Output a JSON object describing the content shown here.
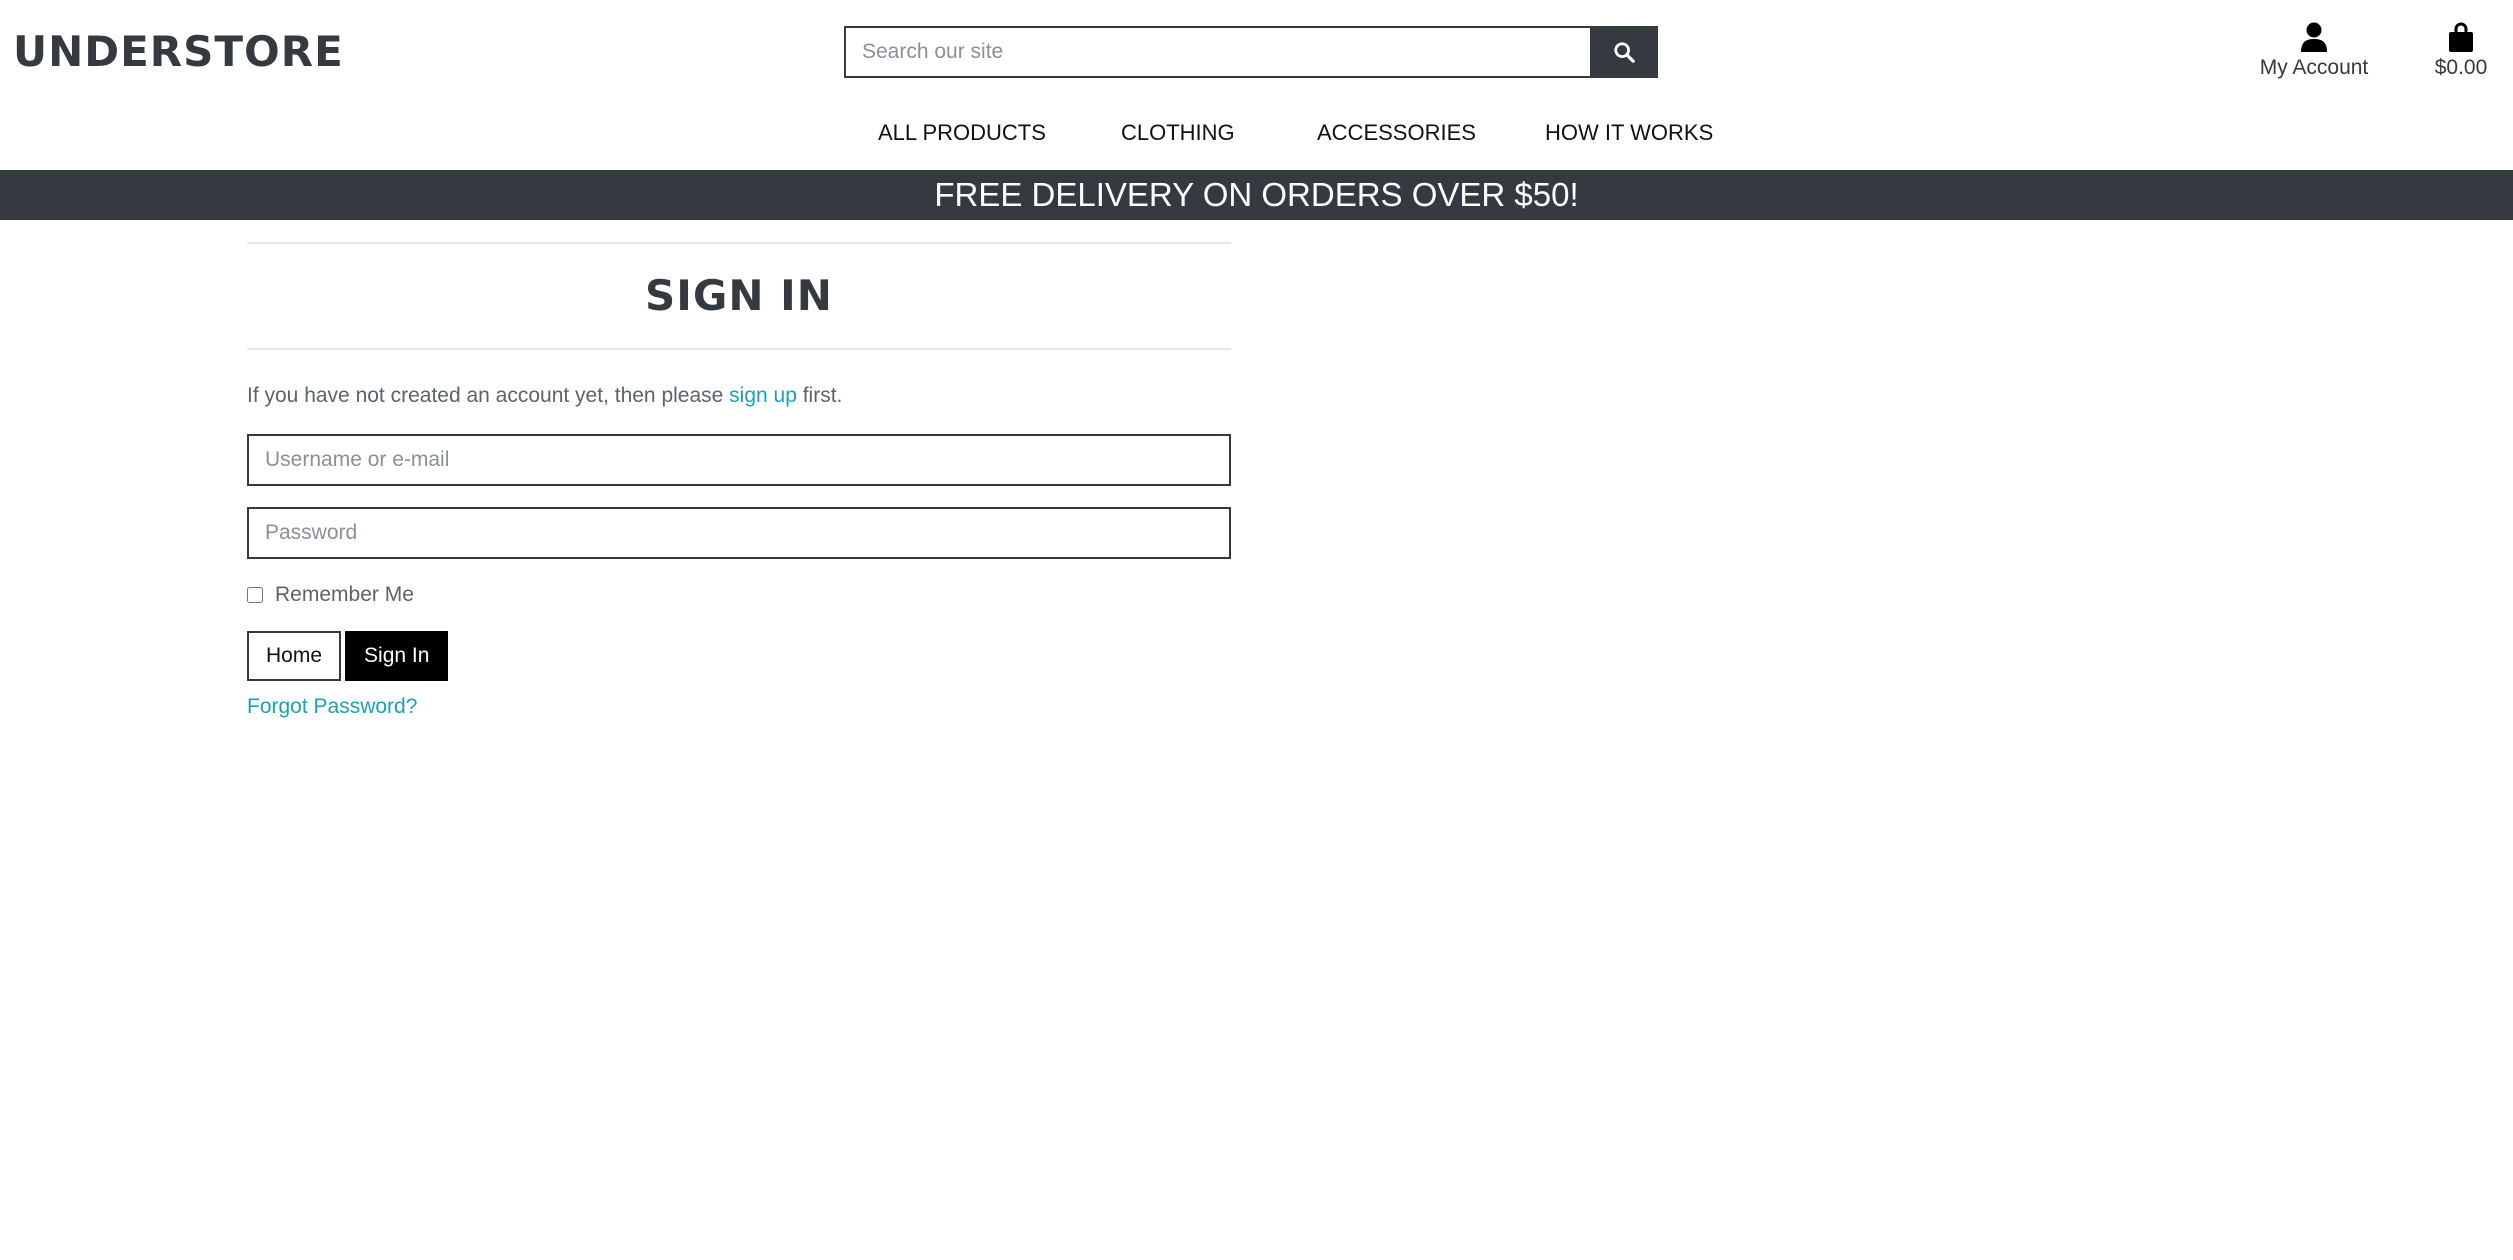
{
  "brand": {
    "name": "UNDERSTORE"
  },
  "search": {
    "placeholder": "Search our site",
    "icon": "search-icon"
  },
  "account": {
    "label": "My Account",
    "icon": "user-icon"
  },
  "cart": {
    "total": "$0.00",
    "icon": "shopping-bag-icon"
  },
  "nav": {
    "items": [
      "ALL PRODUCTS",
      "CLOTHING",
      "ACCESSORIES",
      "HOW IT WORKS"
    ]
  },
  "banner": {
    "text": "FREE DELIVERY ON ORDERS OVER $50!"
  },
  "signin": {
    "title": "SIGN IN",
    "intro_before": "If you have not created an account yet, then please ",
    "intro_link": "sign up",
    "intro_after": " first.",
    "username_placeholder": "Username or e-mail",
    "password_placeholder": "Password",
    "remember_label": "Remember Me",
    "home_button": "Home",
    "signin_button": "Sign In",
    "forgot_link": "Forgot Password?"
  },
  "colors": {
    "dark": "#343a40",
    "link": "#17a2b8",
    "button_black": "#000000"
  }
}
